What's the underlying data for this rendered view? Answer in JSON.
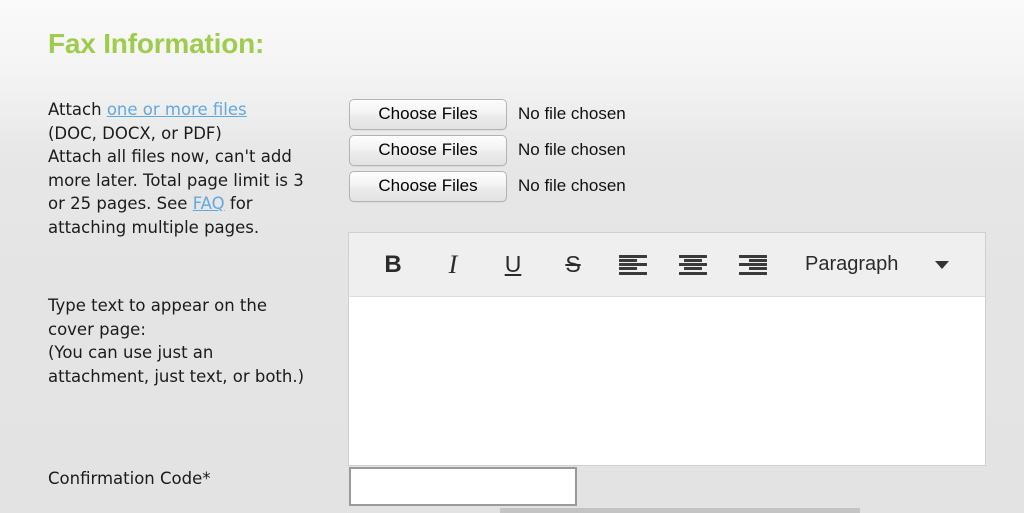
{
  "page": {
    "title": "Fax Information:"
  },
  "attach_section": {
    "line1_prefix": "Attach ",
    "line1_link": "one or more files",
    "line2": "(DOC, DOCX, or PDF)",
    "line3": "Attach all files now, can't add",
    "line4": "more later. Total page limit is 3",
    "line5_prefix": "or 25 pages. See ",
    "line5_link": "FAQ",
    "line5_suffix": " for",
    "line6": "attaching multiple pages."
  },
  "file_inputs": [
    {
      "button_label": "Choose Files",
      "status": "No file chosen"
    },
    {
      "button_label": "Choose Files",
      "status": "No file chosen"
    },
    {
      "button_label": "Choose Files",
      "status": "No file chosen"
    }
  ],
  "cover_section": {
    "line1": "Type text to appear on the",
    "line2": "cover page:",
    "line3": "(You can use just an",
    "line4": "attachment, just text, or both.)"
  },
  "editor": {
    "toolbar": {
      "bold": "B",
      "italic": "I",
      "underline": "U",
      "strikethrough": "S",
      "align_left_name": "align-left",
      "align_center_name": "align-center",
      "align_right_name": "align-right",
      "format_value": "Paragraph"
    },
    "body_value": ""
  },
  "confirmation": {
    "label": "Confirmation Code*",
    "value": "",
    "placeholder": ""
  },
  "colors": {
    "heading_green": "#9fcc4e",
    "link_blue": "#61a9e0",
    "toolbar_bg": "#efefef",
    "page_bg": "#e3e3e3"
  }
}
